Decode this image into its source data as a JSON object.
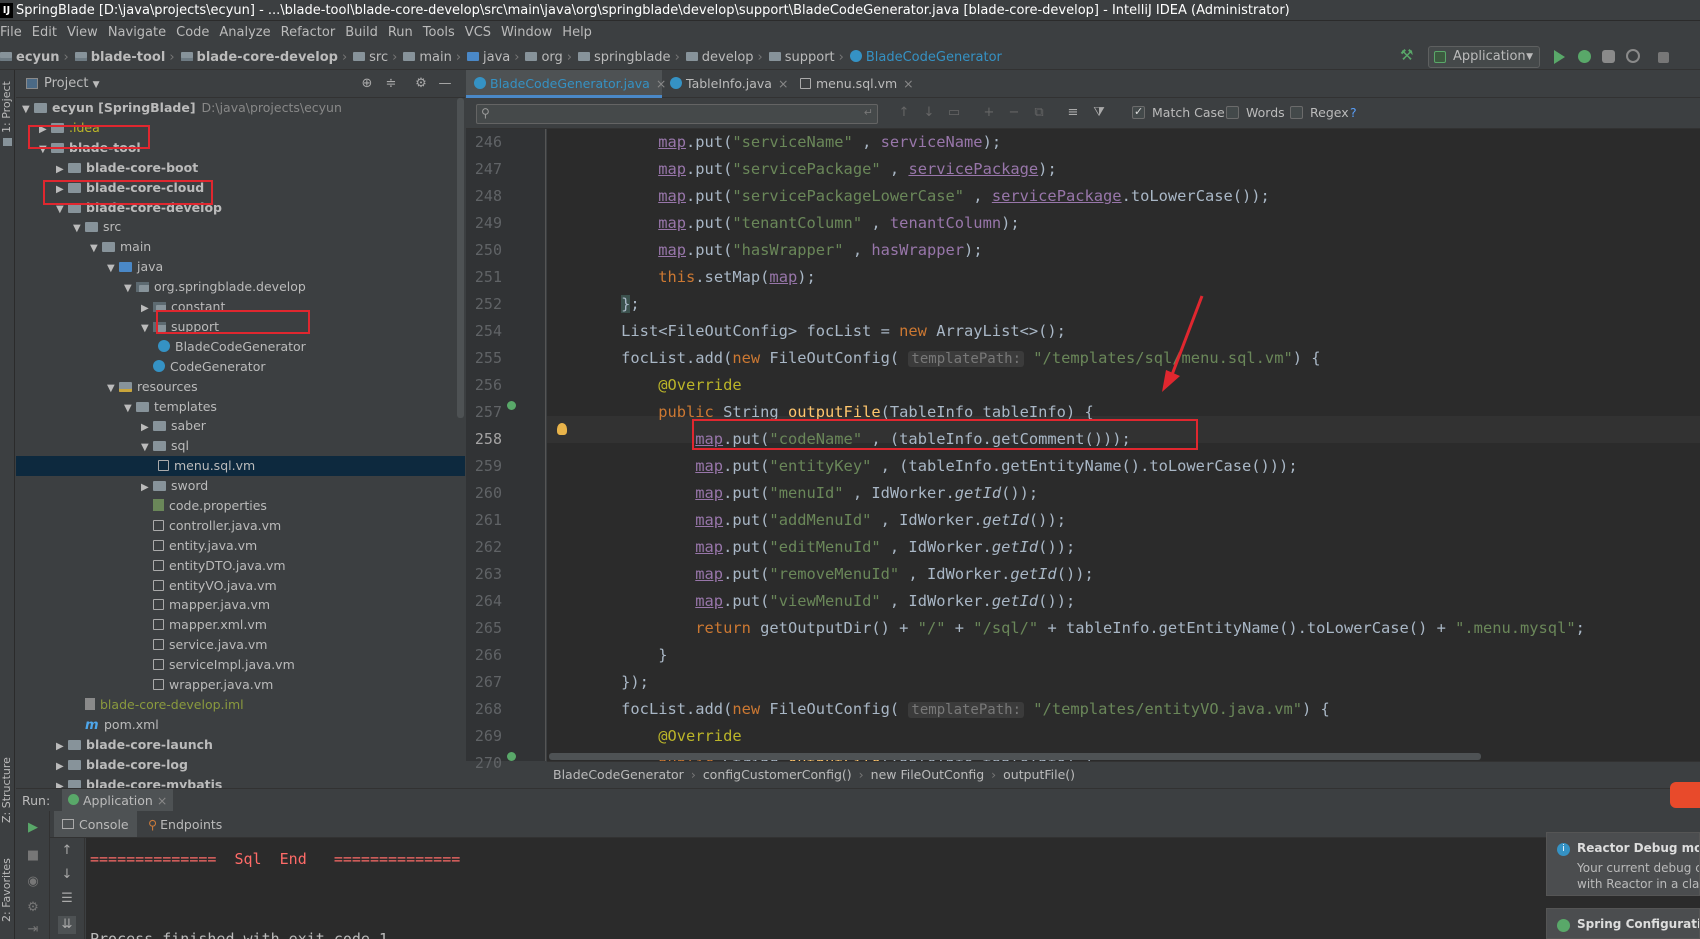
{
  "window": {
    "title": "SpringBlade [D:\\java\\projects\\ecyun] - ...\\blade-tool\\blade-core-develop\\src\\main\\java\\org\\springblade\\develop\\support\\BladeCodeGenerator.java [blade-core-develop] - IntelliJ IDEA (Administrator)",
    "app_icon": "IJ"
  },
  "menu": [
    "File",
    "Edit",
    "View",
    "Navigate",
    "Code",
    "Analyze",
    "Refactor",
    "Build",
    "Run",
    "Tools",
    "VCS",
    "Window",
    "Help"
  ],
  "navbar": {
    "crumbs": [
      "ecyun",
      "blade-tool",
      "blade-core-develop",
      "src",
      "main",
      "java",
      "org",
      "springblade",
      "develop",
      "support",
      "BladeCodeGenerator"
    ],
    "run_config": "Application"
  },
  "left_strip": {
    "project": "1: Project",
    "structure": "Z: Structure",
    "favorites": "2: Favorites"
  },
  "project_panel": {
    "title": "Project",
    "tree": [
      {
        "label": "ecyun [SpringBlade]",
        "hint": "D:\\java\\projects\\ecyun",
        "indent": 0,
        "arrow": "▼",
        "icon": "folder",
        "bold": true
      },
      {
        "label": ".idea",
        "indent": 1,
        "arrow": "▶",
        "icon": "folder",
        "color": "yellow"
      },
      {
        "label": "blade-tool",
        "indent": 1,
        "arrow": "▼",
        "icon": "folder",
        "bold": true
      },
      {
        "label": "blade-core-boot",
        "indent": 2,
        "arrow": "▶",
        "icon": "folder",
        "bold": true
      },
      {
        "label": "blade-core-cloud",
        "indent": 2,
        "arrow": "▶",
        "icon": "folder",
        "bold": true
      },
      {
        "label": "blade-core-develop",
        "indent": 2,
        "arrow": "▼",
        "icon": "folder",
        "bold": true
      },
      {
        "label": "src",
        "indent": 3,
        "arrow": "▼",
        "icon": "folder"
      },
      {
        "label": "main",
        "indent": 4,
        "arrow": "▼",
        "icon": "folder"
      },
      {
        "label": "java",
        "indent": 5,
        "arrow": "▼",
        "icon": "srcf"
      },
      {
        "label": "org.springblade.develop",
        "indent": 6,
        "arrow": "▼",
        "icon": "pkg"
      },
      {
        "label": "constant",
        "indent": 7,
        "arrow": "▶",
        "icon": "pkg"
      },
      {
        "label": "support",
        "indent": 7,
        "arrow": "▼",
        "icon": "pkg"
      },
      {
        "label": "BladeCodeGenerator",
        "indent": 8,
        "arrow": "",
        "icon": "cls"
      },
      {
        "label": "CodeGenerator",
        "indent": 7,
        "arrow": "",
        "icon": "cls",
        "extra": 12
      },
      {
        "label": "resources",
        "indent": 5,
        "arrow": "▼",
        "icon": "resf"
      },
      {
        "label": "templates",
        "indent": 6,
        "arrow": "▼",
        "icon": "folder"
      },
      {
        "label": "saber",
        "indent": 7,
        "arrow": "▶",
        "icon": "folder"
      },
      {
        "label": "sql",
        "indent": 7,
        "arrow": "▼",
        "icon": "folder"
      },
      {
        "label": "menu.sql.vm",
        "indent": 8,
        "arrow": "",
        "icon": "vm",
        "selected": true
      },
      {
        "label": "sword",
        "indent": 7,
        "arrow": "▶",
        "icon": "folder"
      },
      {
        "label": "code.properties",
        "indent": 7,
        "arrow": "",
        "icon": "props",
        "extra": 12
      },
      {
        "label": "controller.java.vm",
        "indent": 7,
        "arrow": "",
        "icon": "vm",
        "extra": 12
      },
      {
        "label": "entity.java.vm",
        "indent": 7,
        "arrow": "",
        "icon": "vm",
        "extra": 12
      },
      {
        "label": "entityDTO.java.vm",
        "indent": 7,
        "arrow": "",
        "icon": "vm",
        "extra": 12
      },
      {
        "label": "entityVO.java.vm",
        "indent": 7,
        "arrow": "",
        "icon": "vm",
        "extra": 12
      },
      {
        "label": "mapper.java.vm",
        "indent": 7,
        "arrow": "",
        "icon": "vm",
        "extra": 12
      },
      {
        "label": "mapper.xml.vm",
        "indent": 7,
        "arrow": "",
        "icon": "vm",
        "extra": 12
      },
      {
        "label": "service.java.vm",
        "indent": 7,
        "arrow": "",
        "icon": "vm",
        "extra": 12
      },
      {
        "label": "serviceImpl.java.vm",
        "indent": 7,
        "arrow": "",
        "icon": "vm",
        "extra": 12
      },
      {
        "label": "wrapper.java.vm",
        "indent": 7,
        "arrow": "",
        "icon": "vm",
        "extra": 12
      },
      {
        "label": "blade-core-develop.iml",
        "indent": 3,
        "arrow": "",
        "icon": "iml",
        "color": "green",
        "extra": 12
      },
      {
        "label": "pom.xml",
        "indent": 3,
        "arrow": "",
        "icon": "m",
        "extra": 12
      },
      {
        "label": "blade-core-launch",
        "indent": 2,
        "arrow": "▶",
        "icon": "folder",
        "bold": true
      },
      {
        "label": "blade-core-log",
        "indent": 2,
        "arrow": "▶",
        "icon": "folder",
        "bold": true
      },
      {
        "label": "blade-core-mybatis",
        "indent": 2,
        "arrow": "▶",
        "icon": "folder",
        "bold": true
      }
    ]
  },
  "editor": {
    "tabs": [
      {
        "label": "BladeCodeGenerator.java",
        "active": true
      },
      {
        "label": "TableInfo.java",
        "active": false
      },
      {
        "label": "menu.sql.vm",
        "active": false
      }
    ],
    "search": {
      "placeholder": "",
      "match_case": "Match Case",
      "words": "Words",
      "regex": "Regex",
      "help": "?"
    },
    "line_numbers": [
      "246",
      "247",
      "248",
      "249",
      "250",
      "251",
      "252",
      "254",
      "255",
      "256",
      "257",
      "258",
      "259",
      "260",
      "261",
      "262",
      "263",
      "264",
      "265",
      "266",
      "267",
      "268",
      "269",
      "270"
    ],
    "breadcrumbs": [
      "BladeCodeGenerator",
      "configCustomerConfig()",
      "new FileOutConfig",
      "outputFile()"
    ]
  },
  "run_panel": {
    "label": "Run:",
    "tab": "Application",
    "console_tab": "Console",
    "endpoints_tab": "Endpoints",
    "console_lines": [
      "==============  Sql  End   ==============",
      "Process finished with exit code 1"
    ]
  },
  "notifications": {
    "reactor_title": "Reactor Debug mod",
    "reactor_body1": "Your current debug c",
    "reactor_body2": "with Reactor in a clas",
    "spring_title": "Spring Configuratio"
  },
  "colors": {
    "accent": "#3592c4",
    "highlight": "#e0272f",
    "keyword": "#cc7832",
    "string": "#6a8759",
    "field": "#9876aa",
    "method": "#ffc66d"
  }
}
